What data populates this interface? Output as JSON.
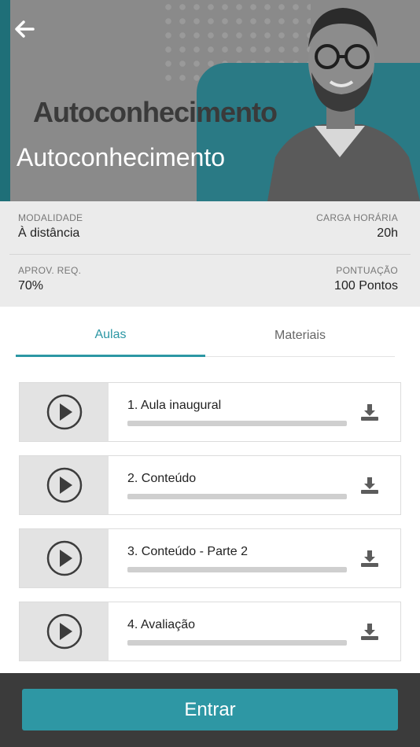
{
  "header": {
    "background_word": "Autoconhecimento",
    "title": "Autoconhecimento"
  },
  "info": {
    "modalidade_label": "MODALIDADE",
    "modalidade_value": "À distância",
    "carga_label": "CARGA HORÁRIA",
    "carga_value": "20h",
    "aprov_label": "APROV. REQ.",
    "aprov_value": "70%",
    "pontuacao_label": "PONTUAÇÃO",
    "pontuacao_value": "100 Pontos"
  },
  "tabs": [
    {
      "label": "Aulas",
      "active": true
    },
    {
      "label": "Materiais",
      "active": false
    }
  ],
  "lessons": [
    {
      "title": "1. Aula inaugural",
      "progress": 0
    },
    {
      "title": "2. Conteúdo",
      "progress": 0
    },
    {
      "title": "3. Conteúdo - Parte 2",
      "progress": 0
    },
    {
      "title": "4. Avaliação",
      "progress": 0
    }
  ],
  "footer": {
    "button_label": "Entrar"
  },
  "colors": {
    "accent": "#2c97a4",
    "footer_bg": "#3b3b3b",
    "info_bg": "#ebebeb"
  },
  "icons": {
    "back": "arrow-left-icon",
    "play": "play-circle-icon",
    "download": "download-icon"
  }
}
